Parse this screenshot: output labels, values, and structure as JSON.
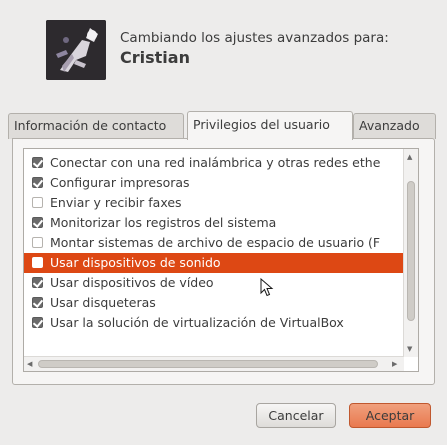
{
  "header": {
    "title": "Cambiando los ajustes avanzados para:",
    "user_name": "Cristian",
    "avatar_icon": "user-avatar-icon"
  },
  "tabs": [
    {
      "label": "Información de contacto",
      "active": false
    },
    {
      "label": "Privilegios del usuario",
      "active": true
    },
    {
      "label": "Avanzado",
      "active": false
    }
  ],
  "privileges": [
    {
      "label": "Conectar con una red inalámbrica y otras redes ethe",
      "checked": true,
      "selected": false
    },
    {
      "label": "Configurar impresoras",
      "checked": true,
      "selected": false
    },
    {
      "label": "Enviar y recibir faxes",
      "checked": false,
      "selected": false
    },
    {
      "label": "Monitorizar los registros del sistema",
      "checked": true,
      "selected": false
    },
    {
      "label": "Montar sistemas de archivo de espacio de usuario (F",
      "checked": false,
      "selected": false
    },
    {
      "label": "Usar dispositivos de sonido",
      "checked": false,
      "selected": true
    },
    {
      "label": "Usar dispositivos de vídeo",
      "checked": true,
      "selected": false
    },
    {
      "label": "Usar disqueteras",
      "checked": true,
      "selected": false
    },
    {
      "label": "Usar la solución de virtualización de VirtualBox",
      "checked": true,
      "selected": false
    }
  ],
  "buttons": {
    "cancel_label": "Cancelar",
    "accept_label": "Aceptar"
  },
  "colors": {
    "selection": "#dd4814",
    "accept_button": "#e9794f",
    "window_bg": "#edeceb"
  }
}
